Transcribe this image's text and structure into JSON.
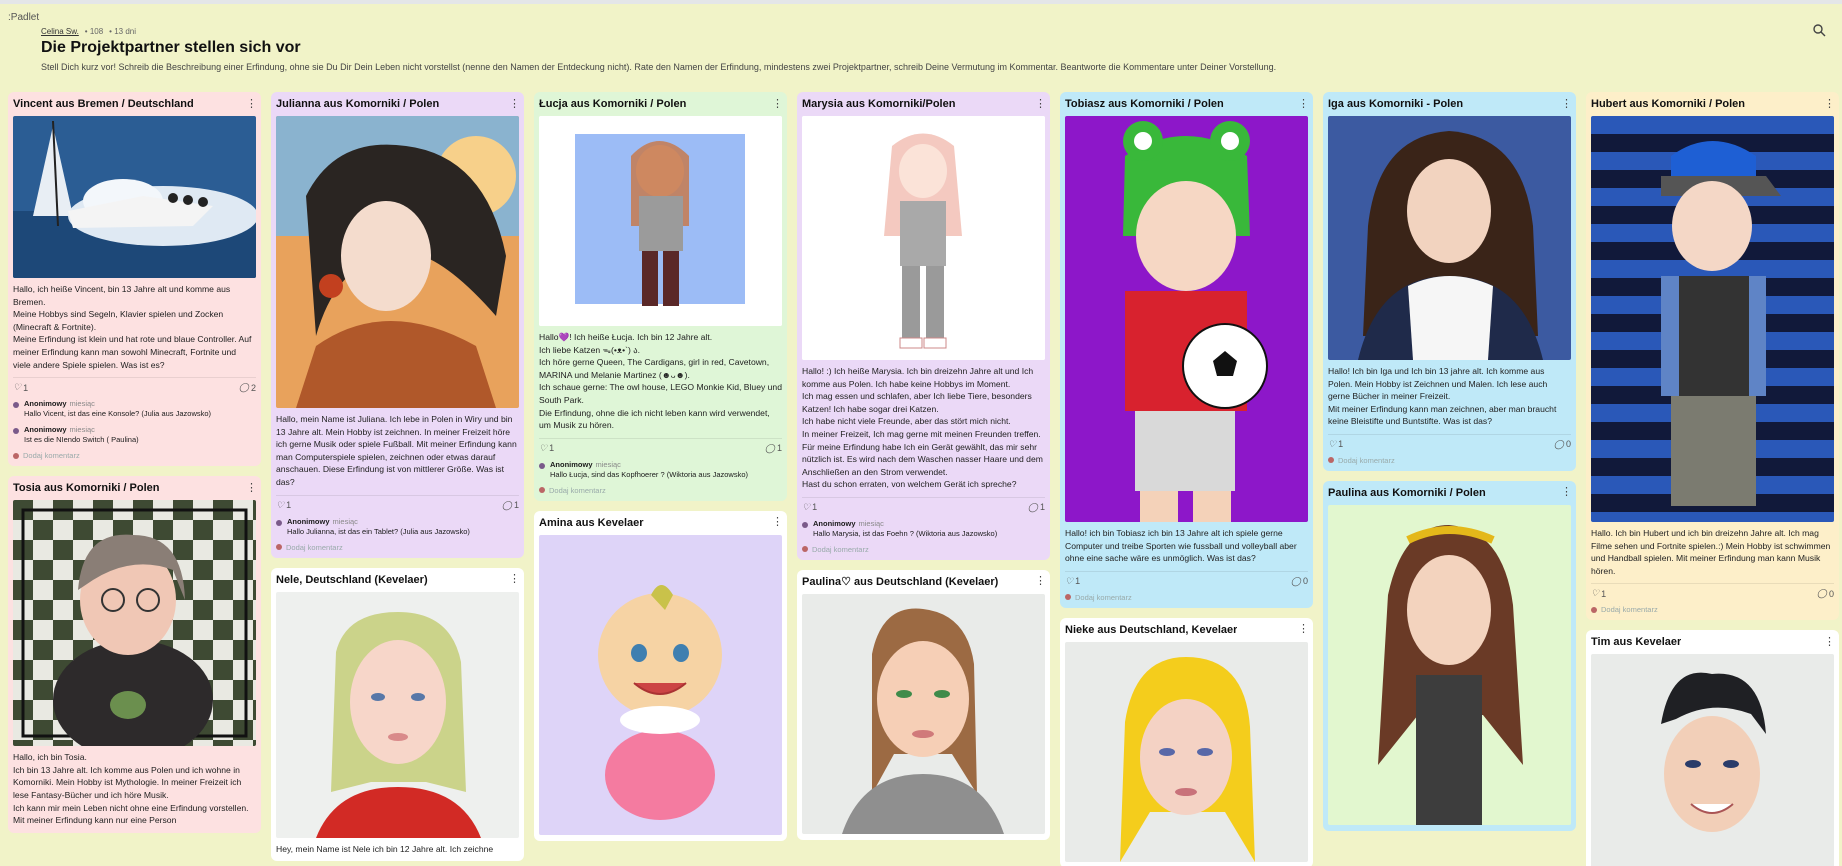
{
  "app": {
    "brand": ":Padlet"
  },
  "header": {
    "author": "Celina Sw.",
    "likes": "• 108",
    "age": "• 13 dni",
    "title": "Die Projektpartner stellen sich vor",
    "description": "Stell Dich kurz vor! Schreib die Beschreibung einer Erfindung, ohne sie Du Dir Dein Leben nicht vorstellst (nenne den Namen der Entdeckung nicht). Rate den Namen der Erfindung, mindestens zwei Projektpartner, schreib Deine Vermutung im Kommentar. Beantworte die Kommentare unter Deiner Vorstellung."
  },
  "ui": {
    "add_comment": "Dodaj komentarz",
    "ago": "miesiąc",
    "kebab": "⋮",
    "heart": "♡"
  },
  "colors": {
    "background": "#f1f3c8",
    "pink": "#fde1e1",
    "lilac": "#ebd9f7",
    "mint": "#dff6d7",
    "sky": "#bfe9f8",
    "cream": "#fdefc9",
    "white": "#ffffff"
  },
  "cards": {
    "vincent": {
      "title": "Vincent aus Bremen / Deutschland",
      "text": "Hallo, ich heiße Vincent, bin 13 Jahre alt und komme aus Bremen.\nMeine Hobbys sind Segeln, Klavier spielen und Zocken (Minecraft & Fortnite).\nMeine Erfindung ist klein und hat rote und blaue Controller. Auf meiner Erfindung kann man sowohl Minecraft, Fortnite und viele andere Spiele spielen. Was ist es?",
      "likes": "1",
      "comments_count": "2",
      "comments": [
        {
          "author": "Anonimowy",
          "text": "Hallo Vicent, ist das eine Konsole? (Julia aus Jazowsko)"
        },
        {
          "author": "Anonimowy",
          "text": "Ist es die NIendo Switch ( Paulina)"
        }
      ]
    },
    "tosia": {
      "title": "Tosia aus Komorniki / Polen",
      "text": "Hallo, ich bin Tosia.\n Ich bin 13 Jahre alt. Ich komme aus Polen und ich wohne in Komorniki. Mein Hobby ist Mythologie. In meiner Freizeit ich lese Fantasy-Bücher und ich höre Musik.\n Ich kann mir mein Leben nicht ohne eine Erfindung vorstellen. Mit meiner Erfindung kann nur eine Person"
    },
    "julianna": {
      "title": "Julianna aus Komorniki / Polen",
      "text": "Hallo, mein Name ist Juliana. Ich lebe in Polen in Wiry und bin 13 Jahre alt. Mein Hobby ist zeichnen. In meiner Freizeit höre ich gerne Musik oder spiele Fußball. Mit meiner Erfindung kann man Computerspiele spielen, zeichnen oder etwas darauf anschauen. Diese Erfindung ist von mittlerer Größe. Was ist das?",
      "likes": "1",
      "comments_count": "1",
      "comments": [
        {
          "author": "Anonimowy",
          "text": "Hallo Julianna, ist das ein Tablet? (Julia aus Jazowsko)"
        }
      ]
    },
    "nele": {
      "title": "Nele, Deutschland (Kevelaer)",
      "text": "Hey, mein Name ist Nele ich bin 12 Jahre alt. Ich zeichne"
    },
    "lucja": {
      "title": "Łucja aus Komorniki / Polen",
      "text": "Hallo💜! Ich heiße Łucja. Ich bin 12 Jahre alt.\nIch liebe Katzen ᯓ(•ᴥ•`) ა.\nIch höre gerne Queen, The Cardigans, girl in red, Cavetown, MARINA und Melanie Martinez (☻ᴗ☻).\nIch schaue gerne: The owl house, LEGO Monkie Kid, Bluey und South Park.\nDie Erfindung, ohne die ich nicht leben kann wird verwendet, um Musik zu hören.",
      "likes": "1",
      "comments_count": "1",
      "comments": [
        {
          "author": "Anonimowy",
          "text": "Hallo Łucja, sind das Kopfhoerer ? (Wiktoria aus Jazowsko)"
        }
      ]
    },
    "amina": {
      "title": "Amina aus Kevelaer"
    },
    "marysia": {
      "title": "Marysia aus Komorniki/Polen",
      "text": "Hallo! :) Ich heiße Marysia. Ich bin dreizehn Jahre alt und Ich komme aus Polen. Ich habe keine Hobbys im Moment.\n Ich mag essen und schlafen, aber Ich liebe Tiere, besonders Katzen! Ich habe sogar drei Katzen.\n Ich habe nicht viele Freunde, aber das stört mich nicht.\n In meiner Freizeit, Ich mag gerne mit meinen Freunden treffen.\n Für meine Erfindung habe Ich ein Gerät gewählt, das mir sehr nützlich ist. Es wird nach dem Waschen nasser Haare und dem Anschließen an den Strom verwendet.\n Hast du schon erraten, von welchem Gerät ich spreche?",
      "likes": "1",
      "comments_count": "1",
      "comments": [
        {
          "author": "Anonimowy",
          "text": "Hallo Marysia, ist das Foehn ? (Wiktoria aus Jazowsko)"
        }
      ]
    },
    "paulina_de": {
      "title": "Paulina♡ aus Deutschland (Kevelaer)"
    },
    "tobiasz": {
      "title": "Tobiasz aus Komorniki / Polen",
      "text": "Hallo! ich bin Tobiasz ich bin 13 Jahre alt ich spiele gerne Computer und treibe Sporten wie fussball und volleyball aber ohne eine sache wäre es unmöglich. Was ist das?",
      "likes": "1",
      "comments_count": "0"
    },
    "nieke": {
      "title": "Nieke aus Deutschland, Kevelaer"
    },
    "iga": {
      "title": "Iga aus Komorniki - Polen",
      "text": "Hallo! Ich bin Iga und Ich bin 13 jahre alt. Ich komme aus Polen. Mein Hobby ist Zeichnen und Malen. Ich lese auch gerne Bücher in meiner Freizeit.\n Mit meiner Erfindung kann man zeichnen, aber man braucht keine Bleistifte und Buntstifte. Was ist das?",
      "likes": "1",
      "comments_count": "0"
    },
    "paulina_pl": {
      "title": "Paulina aus Komorniki / Polen"
    },
    "hubert": {
      "title": "Hubert aus Komorniki / Polen",
      "text": "Hallo. Ich bin Hubert und ich bin dreizehn Jahre alt. Ich mag Filme sehen und Fortnite spielen.:) Mein Hobby ist schwimmen und Handball spielen. Mit meiner Erfindung man kann Musik hören.",
      "likes": "1",
      "comments_count": "0"
    },
    "tim": {
      "title": "Tim aus Kevelaer"
    }
  }
}
